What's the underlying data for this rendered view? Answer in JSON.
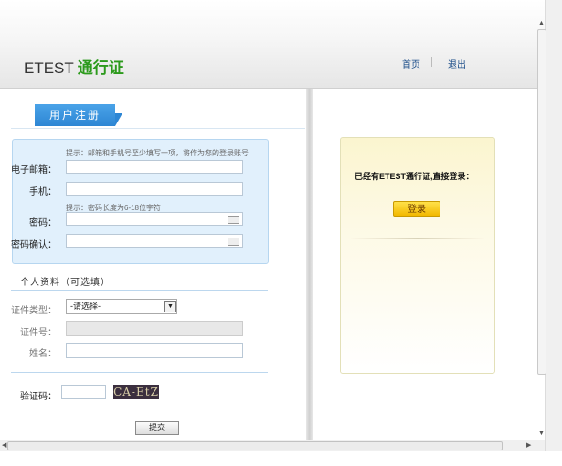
{
  "header": {
    "logo_text": "ETEST",
    "logo_highlight": "通行证",
    "nav": [
      {
        "label": "首页"
      },
      {
        "label": "退出"
      }
    ]
  },
  "register": {
    "tab_label": "用户注册",
    "hint_account": "提示：邮箱和手机号至少填写一项，将作为您的登录账号",
    "email_label": "电子邮箱：",
    "phone_label": "手机：",
    "hint_password": "提示：密码长度为6-18位字符",
    "password_label": "密码：",
    "password_confirm_label": "密码确认：",
    "email_value": "",
    "phone_value": "",
    "password_value": "",
    "password_confirm_value": ""
  },
  "profile": {
    "section_title": "个人资料（可选填）",
    "id_type_label": "证件类型：",
    "id_type_selected": "-请选择-",
    "id_number_label": "证件号：",
    "name_label": "姓名：",
    "id_number_value": "",
    "name_value": ""
  },
  "captcha": {
    "label": "验证码：",
    "value": "",
    "image_text": "CA-EtZ"
  },
  "submit_label": "提交",
  "login": {
    "text": "已经有ETEST通行证,直接登录：",
    "button_label": "登录"
  },
  "colors": {
    "brand_green": "#2c9a1c",
    "tab_blue": "#2d86d4",
    "login_button_yellow": "#f2b800"
  },
  "icons": [
    "keyboard-icon",
    "dropdown-arrow-icon",
    "scroll-left-icon",
    "scroll-right-icon",
    "scroll-up-icon",
    "scroll-down-icon"
  ]
}
